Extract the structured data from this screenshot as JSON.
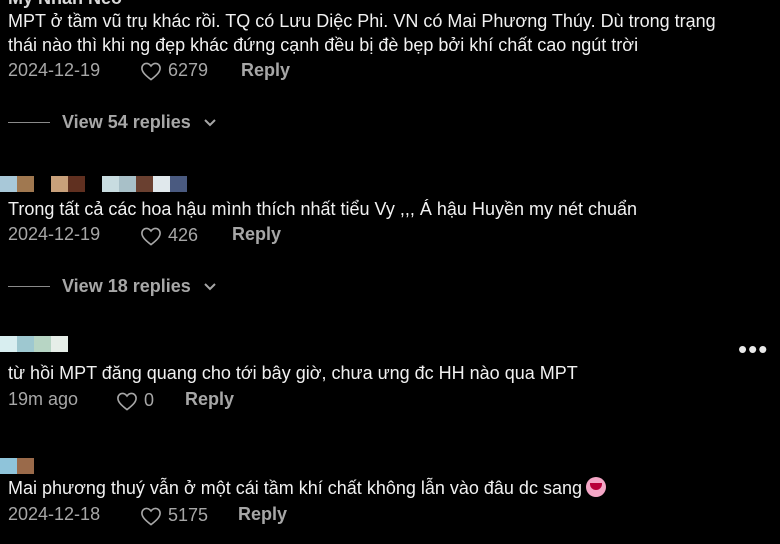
{
  "comments": [
    {
      "username": "My Nhan Neo",
      "text_line1": "MPT ở tầm vũ trụ khác rồi. TQ có Lưu Diệc Phi. VN có Mai Phương Thúy. Dù trong trạng",
      "text_line2": "thái nào thì khi ng đẹp khác đứng cạnh đều bị đè bẹp bởi khí chất cao ngút trời",
      "date": "2024-12-19",
      "likes": "6279",
      "reply_label": "Reply",
      "view_replies": "View 54 replies"
    },
    {
      "text": "Trong tất cả các hoa hậu mình thích nhất tiểu Vy ,,, Á hậu Huyền my nét chuẩn",
      "date": "2024-12-19",
      "likes": "426",
      "reply_label": "Reply",
      "view_replies": "View 18 replies"
    },
    {
      "text": "từ hồi MPT đăng quang cho tới bây giờ, chưa ưng đc HH nào qua MPT",
      "date": "19m ago",
      "likes": "0",
      "reply_label": "Reply",
      "more_label": "•••"
    },
    {
      "text": "Mai phương thuý vẫn ở một cái tầm khí chất không lẫn vào đâu dc sang",
      "emoji": "smiling-face-with-hearts",
      "date": "2024-12-18",
      "likes": "5175",
      "reply_label": "Reply"
    }
  ],
  "colors": {
    "background": "#000000",
    "text": "#f1f1f1",
    "muted": "#a7a7a7"
  }
}
